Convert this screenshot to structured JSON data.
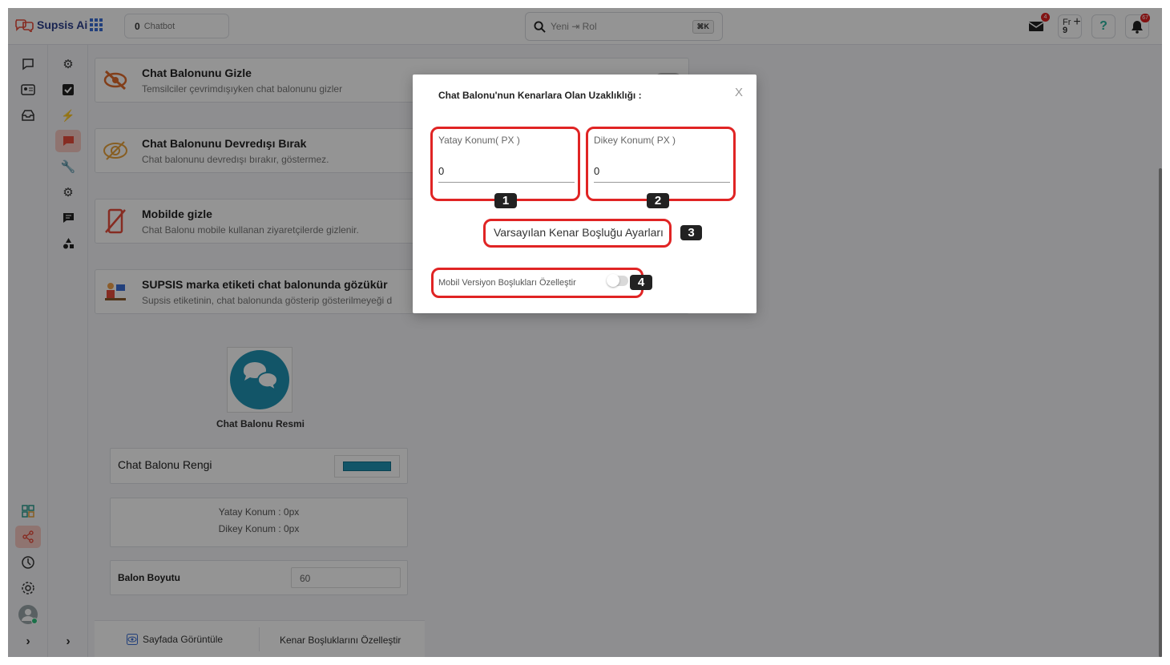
{
  "app": {
    "brand": "Supsis Ai",
    "chatbot_count": "0",
    "chatbot_label": "Chatbot",
    "search_value": "Yeni ⇥ Rol",
    "search_kbd": "⌘K",
    "mail_badge": "4",
    "notif_badge": "67",
    "fr_label": "Fr",
    "fr_count": "9"
  },
  "cards": [
    {
      "title": "Chat Balonunu Gizle",
      "subtitle": "Temsilciler çevrimdışıyken chat balonunu gizler"
    },
    {
      "title": "Chat Balonunu Devredışı Bırak",
      "subtitle": "Chat balonunu devredışı bırakır, göstermez."
    },
    {
      "title": "Mobilde gizle",
      "subtitle": "Chat Balonu mobile kullanan ziyaretçilerde gizlenir."
    },
    {
      "title": "SUPSIS marka etiketi chat balonunda gözükür",
      "subtitle": "Supsis etiketinin, chat balonunda gösterip gösterilmeyeği d"
    }
  ],
  "bubble": {
    "image_caption": "Chat Balonu Resmi",
    "color_label": "Chat Balonu Rengi",
    "color_value": "#1f93b4",
    "position_h": "Yatay Konum : 0px",
    "position_v": "Dikey Konum : 0px",
    "size_label": "Balon Boyutu",
    "size_value": "60",
    "view_button": "Sayfada Görüntüle",
    "edge_button": "Kenar Boşluklarını Özelleştir"
  },
  "modal": {
    "title": "Chat Balonu'nun Kenarlara Olan Uzaklıklığı :",
    "close": "X",
    "horizontal_label": "Yatay Konum( PX )",
    "horizontal_value": "0",
    "vertical_label": "Dikey Konum( PX )",
    "vertical_value": "0",
    "defaults_link": "Varsayılan Kenar Boşluğu Ayarları",
    "mobile_label": "Mobil Versiyon Boşlukları Özelleştir",
    "mobile_enabled": false
  },
  "markers": [
    "1",
    "2",
    "3",
    "4"
  ],
  "colors": {
    "highlight": "#e02424",
    "active_nav": "#f7c8c2",
    "brand_red": "#e74c3c"
  }
}
